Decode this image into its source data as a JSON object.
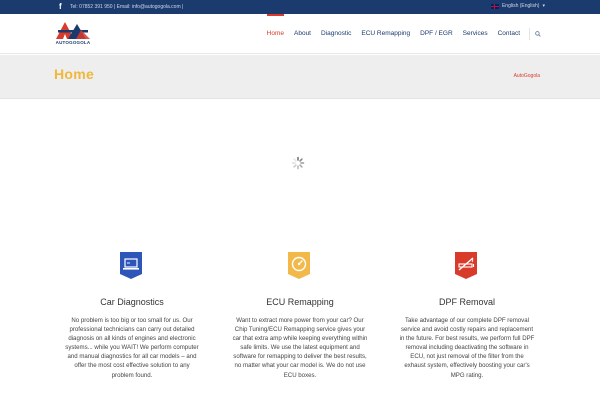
{
  "topbar": {
    "facebook_icon": "facebook-icon",
    "contact": "Tel: 07852 391 950 | Email: info@autogogola.com |",
    "language": "English (English)"
  },
  "header": {
    "logo_text": "AUTOGOGOLA",
    "nav": [
      {
        "label": "Home",
        "active": true
      },
      {
        "label": "About"
      },
      {
        "label": "Diagnostic"
      },
      {
        "label": "ECU Remapping"
      },
      {
        "label": "DPF / EGR"
      },
      {
        "label": "Services"
      },
      {
        "label": "Contact"
      }
    ],
    "search_icon": "search-icon"
  },
  "titlebar": {
    "title": "Home",
    "breadcrumb": "AutoGogola"
  },
  "features": [
    {
      "icon": "laptop-icon",
      "color": "#2e55b8",
      "title": "Car Diagnostics",
      "text": "No problem is too big or too small for us. Our professional technicians can carry out detailed diagnosis on all kinds of engines and electronic systems... while you WAIT! We perform computer and manual diagnostics for all car models – and offer the most cost effective solution to any problem found."
    },
    {
      "icon": "dashboard-icon",
      "color": "#f2b94a",
      "title": "ECU Remapping",
      "text": "Want to extract more power from your car? Our Chip Tuning/ECU Remapping service gives your car that extra amp while keeping everything within safe limits. We use the latest equipment and software for remapping to deliver the best results, no matter what your car model is. We do not use ECU boxes."
    },
    {
      "icon": "no-smoking-icon",
      "color": "#d93b2b",
      "title": "DPF Removal",
      "text": "Take advantage of our complete DPF removal service and avoid costly repairs and replacement in the future. For best results, we perform full DPF removal including deactivating the software in ECU, not just removal of the filter from the exhaust system, effectively boosting your car's MPG rating."
    }
  ],
  "colors": {
    "topbar": "#1b3a6e",
    "accent": "#d93b2b",
    "title": "#f0b83a"
  }
}
